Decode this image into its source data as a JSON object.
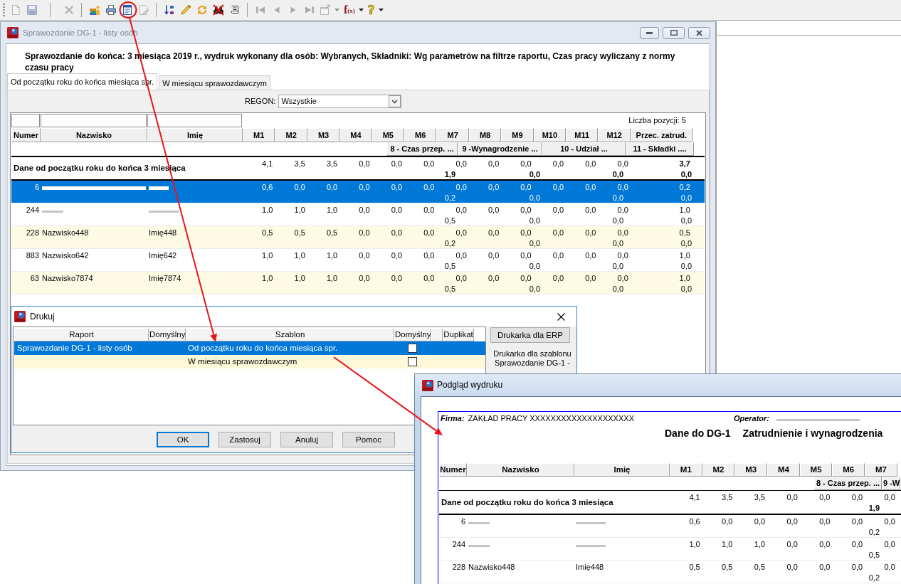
{
  "toolbar": {
    "groups": [
      {
        "buttons": [
          {
            "disabled": true
          },
          {
            "disabled": true
          }
        ]
      },
      {
        "buttons": [
          {
            "disabled": true
          }
        ]
      },
      {
        "buttons": [
          {
            "disabled": false
          },
          {
            "disabled": false
          },
          {
            "disabled": false
          },
          {
            "disabled": true
          }
        ]
      },
      {
        "buttons": [
          {
            "disabled": false
          },
          {
            "disabled": false
          },
          {
            "disabled": false
          },
          {
            "disabled": false
          },
          {
            "disabled": false
          }
        ]
      },
      {
        "buttons": [
          {
            "disabled": true
          },
          {
            "disabled": true
          },
          {
            "disabled": true
          },
          {
            "disabled": true
          },
          {
            "disabled": true,
            "menu": true
          },
          {
            "disabled": false,
            "menu": true,
            "glyph": "f$_{(x)}$"
          },
          {
            "disabled": false,
            "menu": true,
            "glyph": "?"
          }
        ]
      }
    ]
  },
  "main_window": {
    "title": "Sprawozdanie DG-1 - listy osób",
    "active": false,
    "heading": "Sprawozdanie do końca: 3 miesiąca 2019 r., wydruk wykonany dla osób: Wybranych, Składniki: Wg parametrów na filtrze raportu, Czas pracy wyliczany z normy czasu pracy",
    "tabs": [
      {
        "label": "Od początku roku do końca miesiąca spr.",
        "selected": true
      },
      {
        "label": "W miesiącu sprawozdawczym",
        "selected": false
      }
    ],
    "regon": {
      "label": "REGON:",
      "value": "Wszystkie"
    },
    "table": {
      "count": "Liczba pozycji: 5",
      "columns": [
        {
          "label": "Numer",
          "filter": true
        },
        {
          "label": "Nazwisko",
          "filter": true
        },
        {
          "label": "Imię",
          "filter": true
        },
        {
          "label": "M1"
        },
        {
          "label": "M2"
        },
        {
          "label": "M3"
        },
        {
          "label": "M4"
        },
        {
          "label": "M5"
        },
        {
          "label": "M6"
        },
        {
          "label": "M7"
        },
        {
          "label": "M8"
        },
        {
          "label": "M9"
        },
        {
          "label": "M10"
        },
        {
          "label": "M11"
        },
        {
          "label": "M12"
        },
        {
          "label": "Przec. zatrud."
        }
      ],
      "group_columns": [
        "8 - Czas przep. ...",
        "9 -Wynagrodzenie ...",
        "10 - Udział ...",
        "11 - Składki ...."
      ],
      "summary": {
        "label": "Dane od początku roku do końca 3 miesiąca",
        "values": [
          "4,1",
          "3,5",
          "3,5",
          "0,0",
          "0,0",
          "0,0",
          "0,0",
          "0,0",
          "0,0",
          "0,0",
          "0,0",
          "0,0",
          "3,7"
        ],
        "group_values": [
          "1,9",
          "0,0",
          "0,0",
          "0,0"
        ]
      },
      "rows": [
        {
          "numer": "6",
          "redacted": true,
          "selected": true,
          "values": [
            "0,6",
            "0,0",
            "0,0",
            "0,0",
            "0,0",
            "0,0",
            "0,0",
            "0,0",
            "0,0",
            "0,0",
            "0,0",
            "0,0",
            "0,2"
          ],
          "group_values": [
            "0,2",
            "0,0",
            "0,0",
            "0,0"
          ]
        },
        {
          "numer": "244",
          "redacted": true,
          "selected": false,
          "values": [
            "1,0",
            "1,0",
            "1,0",
            "0,0",
            "0,0",
            "0,0",
            "0,0",
            "0,0",
            "0,0",
            "0,0",
            "0,0",
            "0,0",
            "1,0"
          ],
          "group_values": [
            "0,5",
            "0,0",
            "0,0",
            "0,0"
          ]
        },
        {
          "numer": "228",
          "nazwisko": "Nazwisko448",
          "imie": "Imię448",
          "redacted": false,
          "selected": false,
          "values": [
            "0,5",
            "0,5",
            "0,5",
            "0,0",
            "0,0",
            "0,0",
            "0,0",
            "0,0",
            "0,0",
            "0,0",
            "0,0",
            "0,0",
            "0,5"
          ],
          "group_values": [
            "0,2",
            "0,0",
            "0,0",
            "0,0"
          ]
        },
        {
          "numer": "883",
          "nazwisko": "Nazwisko642",
          "imie": "Imię642",
          "redacted": false,
          "selected": false,
          "values": [
            "1,0",
            "1,0",
            "1,0",
            "0,0",
            "0,0",
            "0,0",
            "0,0",
            "0,0",
            "0,0",
            "0,0",
            "0,0",
            "0,0",
            "1,0"
          ],
          "group_values": [
            "0,5",
            "0,0",
            "0,0",
            "0,0"
          ]
        },
        {
          "numer": "63",
          "nazwisko": "Nazwisko7874",
          "imie": "Imię7874",
          "redacted": false,
          "selected": false,
          "values": [
            "1,0",
            "1,0",
            "1,0",
            "0,0",
            "0,0",
            "0,0",
            "0,0",
            "0,0",
            "0,0",
            "0,0",
            "0,0",
            "0,0",
            "1,0"
          ],
          "group_values": [
            "0,5",
            "0,0",
            "0,0",
            "0,0"
          ]
        }
      ]
    }
  },
  "print_dialog": {
    "title": "Drukuj",
    "columns": [
      {
        "label": "Raport"
      },
      {
        "label": "Domyślny"
      },
      {
        "label": "Szablon"
      },
      {
        "label": "Domyślny"
      },
      {},
      {
        "label": "Duplikat"
      }
    ],
    "rows": [
      {
        "raport": "Sprawozdanie DG-1 - listy osób",
        "szablon": "Od początku roku do końca miesiąca spr.",
        "default_checked": false,
        "selected": true
      },
      {
        "szablon": "W miesiącu sprawozdawczym",
        "default_checked": false,
        "selected": false
      }
    ],
    "printer_button": "Drukarka dla ERP",
    "printer_note": "Drukarka dla szablonu Sprawozdanie DG-1 -",
    "buttons": [
      {
        "label": "OK",
        "default": true
      },
      {
        "label": "Zastosuj",
        "default": false
      },
      {
        "label": "Anuluj",
        "default": false
      },
      {
        "label": "Pomoc",
        "default": false
      }
    ]
  },
  "preview_window": {
    "title": "Podgląd wydruku",
    "active": true,
    "company_label": "Firma:",
    "company": "ZAKŁAD PRACY XXXXXXXXXXXXXXXXXXXX",
    "operator_label": "Operator:",
    "operator_redacted": true,
    "report_title": "Dane do DG-1",
    "report_subtitle": "Zatrudnienie i wynagrodzenia",
    "table": {
      "columns": [
        {
          "label": "Numer"
        },
        {
          "label": "Nazwisko"
        },
        {
          "label": "Imię"
        },
        {
          "label": "M1"
        },
        {
          "label": "M2"
        },
        {
          "label": "M3"
        },
        {
          "label": "M4"
        },
        {
          "label": "M5"
        },
        {
          "label": "M6"
        },
        {
          "label": "M7"
        }
      ],
      "group_columns": [
        "8 - Czas przep. ...",
        "9 -W"
      ],
      "summary": {
        "label": "Dane od początku roku do końca 3 miesiąca",
        "values": [
          "4,1",
          "3,5",
          "3,5",
          "0,0",
          "0,0",
          "0,0",
          "0,0"
        ],
        "group_values": [
          "1,9"
        ]
      },
      "rows": [
        {
          "numer": "6",
          "redacted": true,
          "values": [
            "0,6",
            "0,0",
            "0,0",
            "0,0",
            "0,0",
            "0,0",
            "0,0"
          ],
          "group_values": [
            "0,2"
          ]
        },
        {
          "numer": "244",
          "redacted": true,
          "values": [
            "1,0",
            "1,0",
            "1,0",
            "0,0",
            "0,0",
            "0,0",
            "0,0"
          ],
          "group_values": [
            "0,5"
          ]
        },
        {
          "numer": "228",
          "nazwisko": "Nazwisko448",
          "imie": "Imię448",
          "redacted": false,
          "values": [
            "0,5",
            "0,5",
            "0,5",
            "0,0",
            "0,0",
            "0,0",
            "0,0"
          ],
          "group_values": [
            "0,2"
          ]
        }
      ]
    }
  },
  "annotations": [
    {
      "kind": "circle"
    },
    {
      "kind": "arrow"
    },
    {
      "kind": "arrow"
    }
  ]
}
